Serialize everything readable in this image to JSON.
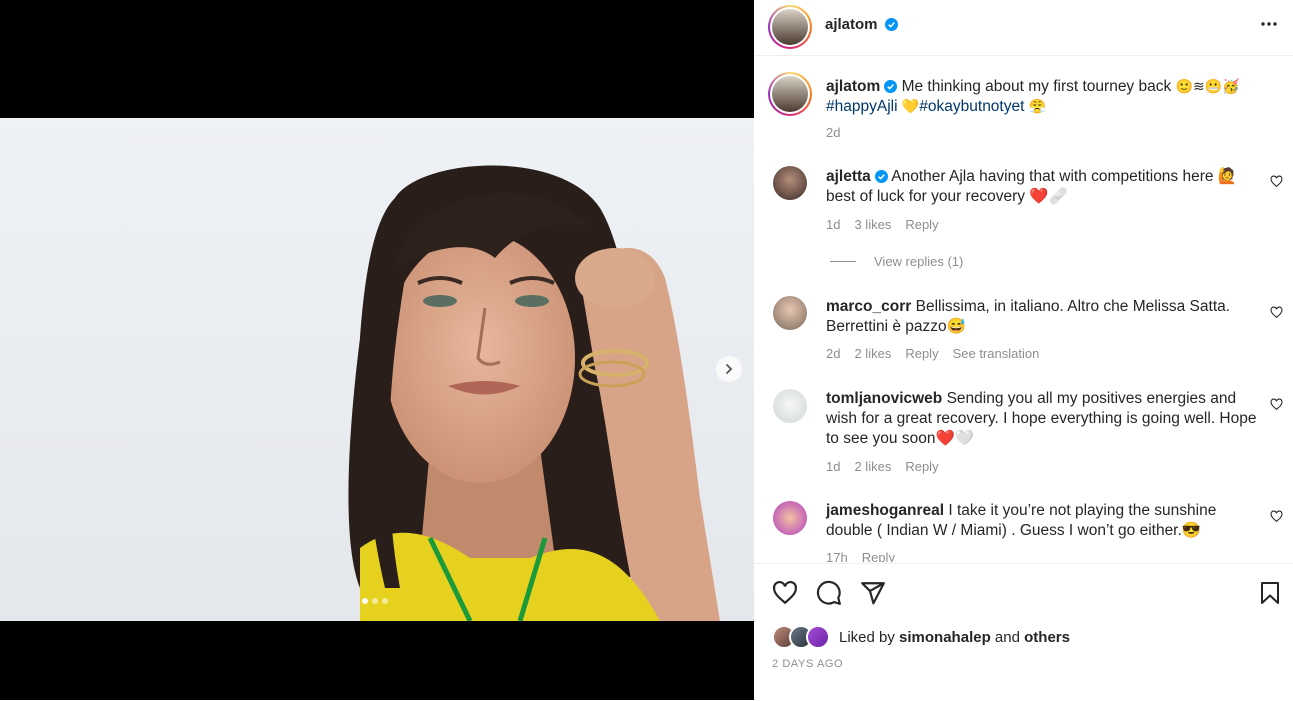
{
  "post": {
    "username": "ajlatom",
    "caption_text": "Me thinking about my first tourney back",
    "caption_emojis": "🙂≋😬🥳",
    "hashtag1": "#happyAjli",
    "heart_emoji": "💛",
    "hashtag2": "#okaybutnotyet",
    "end_emoji": "😤",
    "age": "2d"
  },
  "comments": [
    {
      "username": "ajletta",
      "text": "Another Ajla having that with competitions here 🙋 best of luck for your recovery ❤️🩹",
      "age": "1d",
      "likes": "3 likes",
      "reply": "Reply"
    },
    {
      "username": "marco_corr",
      "text": "Bellissima, in italiano. Altro che Melissa Satta. Berrettini è pazzo😅",
      "age": "2d",
      "likes": "2 likes",
      "reply": "Reply",
      "translation": "See translation"
    },
    {
      "username": "tomljanovicweb",
      "text": "Sending you all my positives energies and wish for a great recovery. I hope everything is going well. Hope to see you soon❤️🤍",
      "age": "1d",
      "likes": "2 likes",
      "reply": "Reply"
    },
    {
      "username": "jameshoganreal",
      "text": "I take it you’re not playing the sunshine double ( Indian W / Miami) . Guess I won’t go either.😎",
      "age": "17h",
      "reply": "Reply"
    }
  ],
  "view_replies": "View replies (1)",
  "liked_by": {
    "prefix": "Liked by",
    "user": "simonahalep",
    "and": "and",
    "others": "others"
  },
  "timestamp": "2 DAYS AGO",
  "colors": {
    "verified": "#0095f6",
    "hashtag": "#00376b",
    "muted": "#8e8e8e"
  },
  "icons": [
    "more-options-icon",
    "verified-badge-icon",
    "heart-icon",
    "comment-icon",
    "share-icon",
    "bookmark-icon",
    "chevron-right-icon"
  ]
}
